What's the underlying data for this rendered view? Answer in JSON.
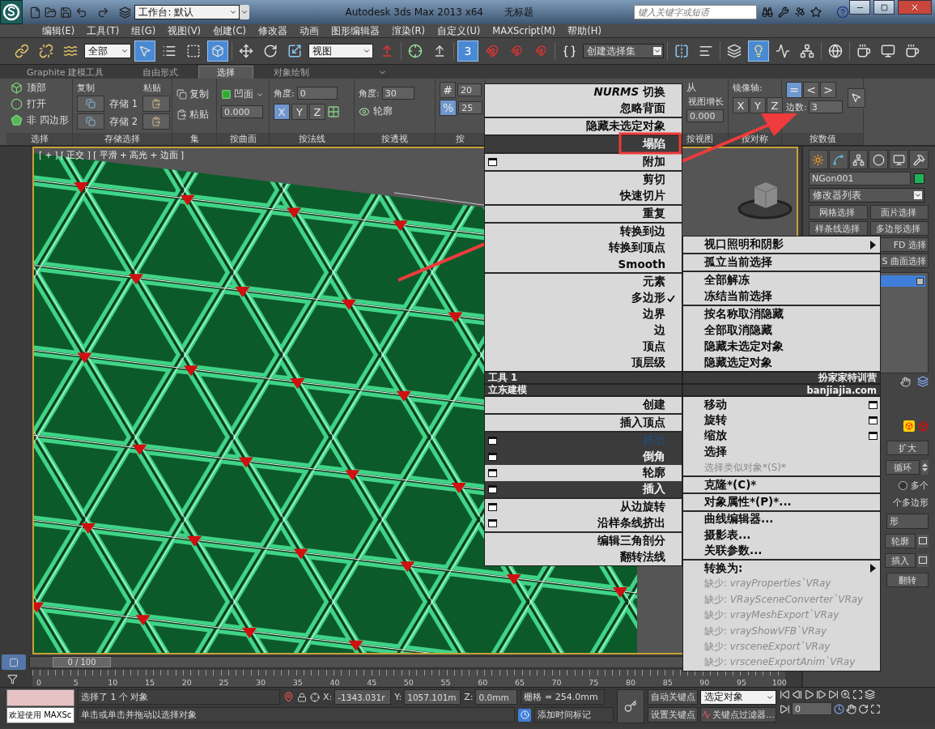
{
  "title_bar": {
    "workspace": "工作台: 默认",
    "app_title": "Autodesk 3ds Max  2013 x64",
    "document": "无标题",
    "search": {
      "placeholder": "键入关键字或短语"
    }
  },
  "menu_bar": [
    "编辑(E)",
    "工具(T)",
    "组(G)",
    "视图(V)",
    "创建(C)",
    "修改器",
    "动画",
    "图形编辑器",
    "渲染(R)",
    "自定义(U)",
    "MAXScript(M)",
    "帮助(H)"
  ],
  "main_toolbar": {
    "selection_filter": "全部",
    "reference_coord": "视图",
    "snap_label": "3",
    "selection_set": "创建选择集"
  },
  "ribbon_tabs": [
    {
      "label": "Graphite 建模工具",
      "selected": false
    },
    {
      "label": "自由形式",
      "selected": false
    },
    {
      "label": "选择",
      "selected": true
    },
    {
      "label": "对象绘制",
      "selected": false
    }
  ],
  "ribbon_groups": [
    {
      "kind": "select",
      "label": "选择",
      "items": [
        "顶部",
        "打开",
        "非 四边形"
      ]
    },
    {
      "kind": "store",
      "label": "存储选择",
      "copy": "复制",
      "paste": "粘贴",
      "slots": [
        "存储 1",
        "存储 2"
      ]
    },
    {
      "kind": "set",
      "label": "集",
      "items": [
        "复制",
        "粘贴"
      ]
    },
    {
      "kind": "surface",
      "label": "按曲面",
      "mode": "凹面",
      "value": "0.000"
    },
    {
      "kind": "normal",
      "label": "按法线",
      "angle_label": "角度:",
      "angle": "0",
      "axes": [
        {
          "label": "X",
          "selected": true
        },
        {
          "label": "Y",
          "selected": false
        },
        {
          "label": "Z",
          "selected": false
        }
      ]
    },
    {
      "kind": "perspective",
      "label": "按透视",
      "angle_label": "角度:",
      "angle": "30",
      "outline": "轮廓"
    },
    {
      "kind": "random",
      "label": "按",
      "buttons": [
        {
          "label": "#",
          "selected": false,
          "value": "20"
        },
        {
          "label": "%",
          "selected": true,
          "value": "25"
        }
      ]
    },
    {
      "kind": "view",
      "label": "按视图",
      "caption_1": "从",
      "caption_2": "视图增长",
      "value": "0.000"
    },
    {
      "kind": "symmetry",
      "label": "按对称",
      "caption": "镜像轴:",
      "axes": [
        {
          "label": "X",
          "selected": false
        },
        {
          "label": "Y",
          "selected": false
        },
        {
          "label": "Z",
          "selected": false
        }
      ]
    },
    {
      "kind": "numeric",
      "label": "按数值",
      "buttons": [
        {
          "label": "=",
          "selected": true
        },
        {
          "label": "<",
          "selected": false
        },
        {
          "label": ">",
          "selected": false
        }
      ],
      "sides_label": "边数:",
      "sides": "3"
    }
  ],
  "viewport": {
    "label": "[ + ] [ 正交 ] [ 平滑 + 高光 + 边面 ]"
  },
  "command_panel": {
    "object_name": "NGon001",
    "modifier_list": "修改器列表",
    "modifier_buttons": [
      "网格选择",
      "面片选择",
      "样条线选择",
      "多边形选择",
      "FD 选择",
      "S 曲面选择"
    ],
    "rows": [
      {
        "kind": "button",
        "label": "扩大"
      },
      {
        "kind": "spinner",
        "label": "循环"
      },
      {
        "kind": "radio",
        "label": "多个",
        "selected": false
      },
      {
        "kind": "text",
        "label": "个多边形"
      },
      {
        "kind": "field",
        "label": "形"
      },
      {
        "kind": "options",
        "label": "轮廓"
      },
      {
        "kind": "options",
        "label": "插入"
      },
      {
        "kind": "button",
        "label": "翻转"
      }
    ]
  },
  "quad_menu": {
    "top_left": {
      "groups": [
        [
          {
            "label": "*NURMS* 切换",
            "kind": "plain",
            "highlighted": false,
            "disabled": false
          },
          {
            "label": "忽略背面",
            "kind": "plain",
            "highlighted": false,
            "disabled": false
          }
        ],
        [
          {
            "label": "隐藏未选定对象",
            "kind": "plain",
            "highlighted": false,
            "disabled": false
          }
        ],
        [
          {
            "label": "塌陷",
            "kind": "plain",
            "highlighted": true,
            "disabled": false
          }
        ],
        [
          {
            "label": "附加",
            "kind": "options",
            "highlighted": false,
            "disabled": false
          }
        ],
        [
          {
            "label": "剪切",
            "kind": "plain",
            "highlighted": false,
            "disabled": false
          },
          {
            "label": "快速切片",
            "kind": "plain",
            "highlighted": false,
            "disabled": false
          }
        ],
        [
          {
            "label": "重复",
            "kind": "plain",
            "highlighted": false,
            "disabled": false
          }
        ],
        [
          {
            "label": "转换到边",
            "kind": "plain",
            "highlighted": false,
            "disabled": false
          },
          {
            "label": "转换到顶点",
            "kind": "plain",
            "highlighted": false,
            "disabled": false
          },
          {
            "label": "Smooth",
            "kind": "plain",
            "highlighted": false,
            "disabled": false
          }
        ],
        [
          {
            "label": "元素",
            "kind": "plain",
            "highlighted": false,
            "disabled": false,
            "checked": false
          },
          {
            "label": "多边形",
            "kind": "plain",
            "highlighted": false,
            "disabled": false,
            "checked": true
          },
          {
            "label": "边界",
            "kind": "plain",
            "highlighted": false,
            "disabled": false,
            "checked": false
          },
          {
            "label": "边",
            "kind": "plain",
            "highlighted": false,
            "disabled": false,
            "checked": false
          },
          {
            "label": "顶点",
            "kind": "plain",
            "highlighted": false,
            "disabled": false,
            "checked": false
          },
          {
            "label": "顶层级",
            "kind": "plain",
            "highlighted": false,
            "disabled": false,
            "checked": false
          }
        ]
      ]
    },
    "top_right": {
      "groups": [
        [
          {
            "label": "视口照明和阴影",
            "kind": "submenu",
            "highlighted": false,
            "disabled": false
          }
        ],
        [
          {
            "label": "孤立当前选择",
            "kind": "plain",
            "highlighted": false,
            "disabled": false
          }
        ],
        [
          {
            "label": "全部解冻",
            "kind": "plain",
            "highlighted": false,
            "disabled": false
          },
          {
            "label": "冻结当前选择",
            "kind": "plain",
            "highlighted": false,
            "disabled": false
          }
        ],
        [
          {
            "label": "按名称取消隐藏",
            "kind": "plain",
            "highlighted": false,
            "disabled": false
          },
          {
            "label": "全部取消隐藏",
            "kind": "plain",
            "highlighted": false,
            "disabled": false
          },
          {
            "label": "隐藏未选定对象",
            "kind": "plain",
            "highlighted": false,
            "disabled": false
          },
          {
            "label": "隐藏选定对象",
            "kind": "plain",
            "highlighted": false,
            "disabled": false
          }
        ]
      ]
    },
    "headers": [
      {
        "left": "工具 1",
        "right": "扮家家特训营"
      },
      {
        "left": "立东建模",
        "right": "banjiajia.com"
      }
    ],
    "bottom_left": {
      "groups": [
        [
          {
            "label": "创建",
            "kind": "plain",
            "highlighted": false,
            "disabled": false
          }
        ],
        [
          {
            "label": "插入顶点",
            "kind": "plain",
            "highlighted": false,
            "disabled": false
          }
        ],
        [
          {
            "label": "挤出",
            "kind": "options",
            "highlighted": true,
            "disabled": true
          },
          {
            "label": "倒角",
            "kind": "options",
            "highlighted": true,
            "disabled": false
          },
          {
            "label": "轮廓",
            "kind": "options",
            "highlighted": false,
            "disabled": false
          },
          {
            "label": "插入",
            "kind": "options",
            "highlighted": true,
            "disabled": false
          }
        ],
        [
          {
            "label": "从边旋转",
            "kind": "options",
            "highlighted": false,
            "disabled": false
          },
          {
            "label": "沿样条线挤出",
            "kind": "options",
            "highlighted": false,
            "disabled": false
          }
        ],
        [
          {
            "label": "编辑三角剖分",
            "kind": "plain",
            "highlighted": false,
            "disabled": false
          },
          {
            "label": "翻转法线",
            "kind": "plain",
            "highlighted": false,
            "disabled": false
          }
        ]
      ]
    },
    "bottom_right": {
      "groups": [
        [
          {
            "label": "移动",
            "kind": "options",
            "highlighted": false,
            "disabled": false
          },
          {
            "label": "旋转",
            "kind": "options",
            "highlighted": false,
            "disabled": false
          },
          {
            "label": "缩放",
            "kind": "options",
            "highlighted": false,
            "disabled": false
          },
          {
            "label": "选择",
            "kind": "plain",
            "highlighted": false,
            "disabled": false
          },
          {
            "label": "选择类似对象*(S)*",
            "kind": "plain",
            "highlighted": false,
            "disabled": true
          }
        ],
        [
          {
            "label": "克隆*(C)*",
            "kind": "plain",
            "highlighted": false,
            "disabled": false
          }
        ],
        [
          {
            "label": "对象属性*(P)*...",
            "kind": "plain",
            "highlighted": false,
            "disabled": false
          }
        ],
        [
          {
            "label": "曲线编辑器...",
            "kind": "plain",
            "highlighted": false,
            "disabled": false
          },
          {
            "label": "摄影表...",
            "kind": "plain",
            "highlighted": false,
            "disabled": false
          },
          {
            "label": "关联参数...",
            "kind": "plain",
            "highlighted": false,
            "disabled": false
          }
        ],
        [
          {
            "label": "转换为:",
            "kind": "submenu",
            "highlighted": false,
            "disabled": false
          },
          {
            "label": "缺少: *vrayProperties`VRay*",
            "kind": "plain",
            "highlighted": false,
            "disabled": true
          },
          {
            "label": "缺少: *VRaySceneConverter`VRay*",
            "kind": "plain",
            "highlighted": false,
            "disabled": true
          },
          {
            "label": "缺少: *vrayMeshExport`VRay*",
            "kind": "plain",
            "highlighted": false,
            "disabled": true
          },
          {
            "label": "缺少: *vrayShowVFB`VRay*",
            "kind": "plain",
            "highlighted": false,
            "disabled": true
          },
          {
            "label": "缺少: *vrsceneExport`VRay*",
            "kind": "plain",
            "highlighted": false,
            "disabled": true
          },
          {
            "label": "缺少: *vrsceneExportAnim`VRay*",
            "kind": "plain",
            "highlighted": false,
            "disabled": true
          }
        ]
      ]
    }
  },
  "timeline": {
    "slider": "0 / 100",
    "level": 0,
    "ticks": [
      "0",
      "5",
      "10",
      "15",
      "20",
      "25",
      "30",
      "35",
      "40",
      "45",
      "50",
      "55",
      "60",
      "65",
      "70",
      "75",
      "80",
      "85",
      "90",
      "95",
      "100"
    ]
  },
  "status_bar": {
    "listener": "欢迎使用 MAXSc",
    "selection": "选择了 1 个 对象",
    "prompt": "单击或单击并拖动以选择对象",
    "coords": [
      {
        "label": "X:",
        "value": "-1343.031r"
      },
      {
        "label": "Y:",
        "value": "1057.101m"
      },
      {
        "label": "Z:",
        "value": "0.0mm"
      }
    ],
    "grid": "栅格 = 254.0mm",
    "auto_key": "自动关键点",
    "key_mode": "选定对象",
    "set_key": "设置关键点",
    "key_filters": "关键点过滤器...",
    "time_tag": "添加时间标记",
    "frame": "0"
  }
}
